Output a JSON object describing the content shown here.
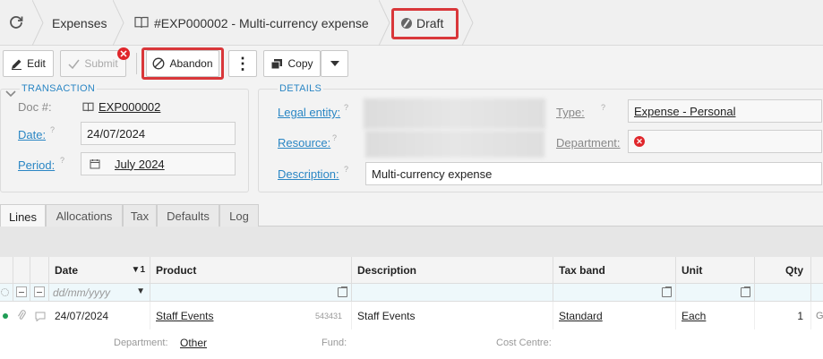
{
  "breadcrumb": {
    "module": "Expenses",
    "document": "#EXP000002 - Multi-currency expense",
    "status": "Draft"
  },
  "toolbar": {
    "edit": "Edit",
    "submit": "Submit",
    "abandon": "Abandon",
    "copy": "Copy"
  },
  "transaction": {
    "section": "TRANSACTION",
    "doc_label": "Doc #:",
    "doc_value": "EXP000002",
    "date_label": "Date:",
    "date_value": "24/07/2024",
    "period_label": "Period:",
    "period_value": "July 2024"
  },
  "details": {
    "section": "DETAILS",
    "legal_entity_label": "Legal entity:",
    "resource_label": "Resource:",
    "description_label": "Description:",
    "description_value": "Multi-currency expense",
    "type_label": "Type:",
    "type_value": "Expense - Personal",
    "department_label": "Department:"
  },
  "tabs": [
    "Lines",
    "Allocations",
    "Tax",
    "Defaults",
    "Log"
  ],
  "grid": {
    "columns": {
      "date": "Date",
      "date_sort": "1",
      "product": "Product",
      "description": "Description",
      "tax_band": "Tax band",
      "unit": "Unit",
      "qty": "Qty"
    },
    "date_placeholder": "dd/mm/yyyy",
    "row": {
      "date": "24/07/2024",
      "product": "Staff Events",
      "product_code": "543431",
      "description": "Staff Events",
      "tax_band": "Standard",
      "unit": "Each",
      "qty": "1",
      "overflow": "G"
    },
    "detail": {
      "department_label": "Department:",
      "department_value": "Other",
      "fund_label": "Fund:",
      "cost_centre_label": "Cost Centre:"
    }
  },
  "colors": {
    "accent": "#2a86c4",
    "highlight": "#d9373a",
    "error": "#e0262b",
    "status_dot": "#1f9d55"
  }
}
